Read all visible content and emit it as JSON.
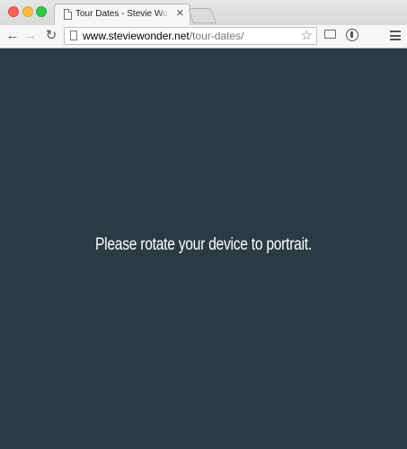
{
  "browser": {
    "tab": {
      "title": "Tour Dates - Stevie Wonder",
      "close_glyph": "✕",
      "icon": "document-icon"
    },
    "toolbar": {
      "back_glyph": "←",
      "forward_glyph": "→",
      "reload_glyph": "↻",
      "url_host": "www.steviewonder.net",
      "url_path": "/tour-dates/",
      "star_glyph": "☆"
    }
  },
  "page": {
    "background_color": "#2b3b44",
    "message": "Please rotate your device to portrait."
  }
}
